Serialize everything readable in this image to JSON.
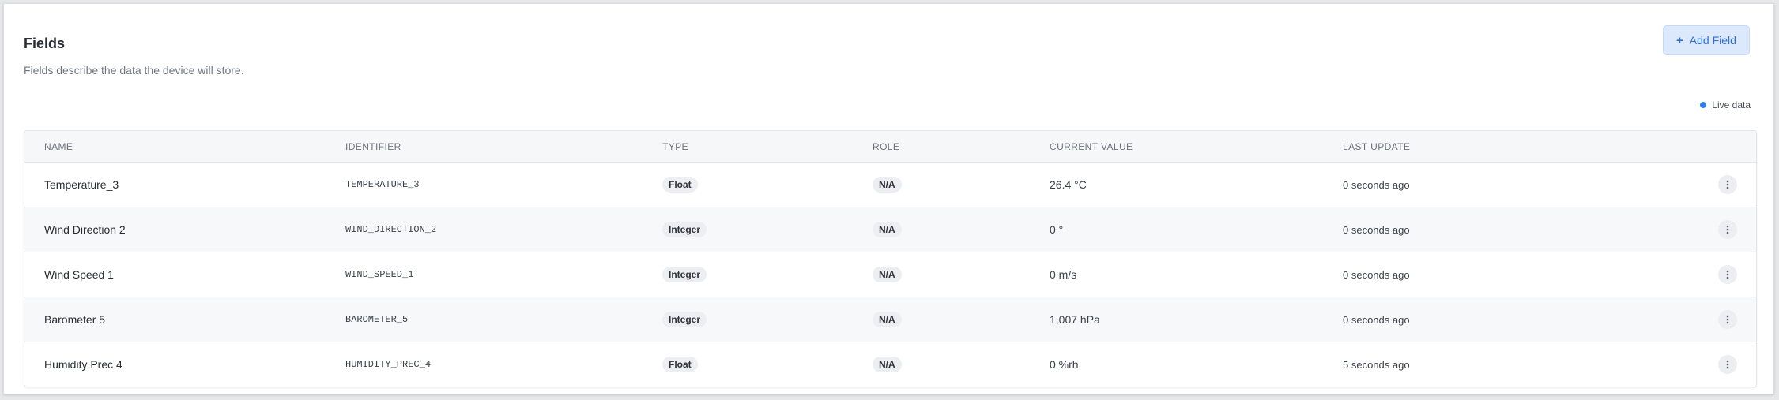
{
  "header": {
    "title": "Fields",
    "subtitle": "Fields describe the data the device will store.",
    "add_button_icon": "+",
    "add_button_label": "Add Field",
    "live_label": "Live data"
  },
  "table": {
    "columns": [
      "Name",
      "Identifier",
      "Type",
      "Role",
      "Current Value",
      "Last Update"
    ],
    "rows": [
      {
        "name": "Temperature_3",
        "identifier": "TEMPERATURE_3",
        "type": "Float",
        "role": "N/A",
        "value": "26.4 °C",
        "updated": "0 seconds ago"
      },
      {
        "name": "Wind Direction 2",
        "identifier": "WIND_DIRECTION_2",
        "type": "Integer",
        "role": "N/A",
        "value": "0 °",
        "updated": "0 seconds ago"
      },
      {
        "name": "Wind Speed 1",
        "identifier": "WIND_SPEED_1",
        "type": "Integer",
        "role": "N/A",
        "value": "0 m/s",
        "updated": "0 seconds ago"
      },
      {
        "name": "Barometer 5",
        "identifier": "BAROMETER_5",
        "type": "Integer",
        "role": "N/A",
        "value": "1,007 hPa",
        "updated": "0 seconds ago"
      },
      {
        "name": "Humidity Prec 4",
        "identifier": "HUMIDITY_PREC_4",
        "type": "Float",
        "role": "N/A",
        "value": "0 %rh",
        "updated": "5 seconds ago"
      }
    ]
  },
  "icons": {
    "row_menu": "more-vertical-icon",
    "live_indicator": "dot-icon"
  },
  "colors": {
    "accent": "#2f6fd6",
    "live_dot": "#2f80ed"
  }
}
